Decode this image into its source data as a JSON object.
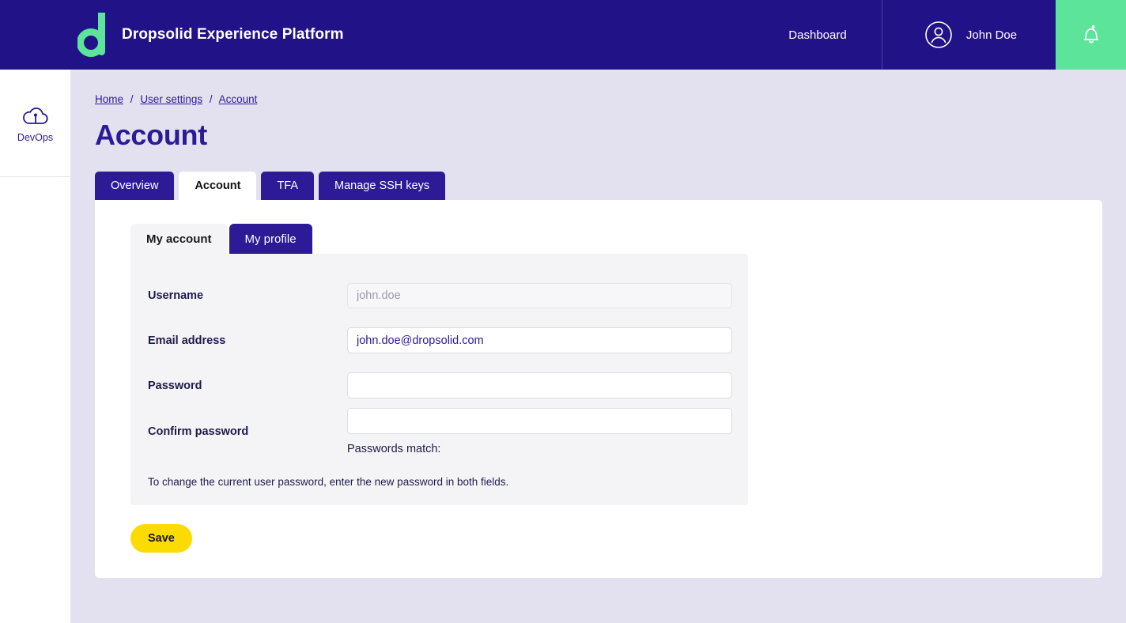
{
  "header": {
    "logo_icon": "dropsolid-d-logo",
    "brand_title": "Dropsolid Experience Platform",
    "dashboard_label": "Dashboard",
    "user_name": "John Doe",
    "avatar_icon": "user-circle-icon",
    "bell_icon": "bell-icon",
    "bg_color": "#221287",
    "bell_bg_color": "#5ce49b"
  },
  "sidebar": {
    "items": [
      {
        "label": "DevOps",
        "icon": "cloud-download-icon"
      }
    ]
  },
  "breadcrumb": {
    "items": [
      "Home",
      "User settings",
      "Account"
    ],
    "separator": "/"
  },
  "page": {
    "title": "Account",
    "accent_color": "#2c1a96",
    "background_color": "#e3e1f0"
  },
  "tabs": [
    {
      "label": "Overview",
      "active": false
    },
    {
      "label": "Account",
      "active": true
    },
    {
      "label": "TFA",
      "active": false
    },
    {
      "label": "Manage SSH keys",
      "active": false
    }
  ],
  "subtabs": [
    {
      "label": "My account",
      "active": true
    },
    {
      "label": "My profile",
      "active": false
    }
  ],
  "form": {
    "fields": [
      {
        "label": "Username",
        "value": "",
        "placeholder": "john.doe",
        "disabled": true,
        "type": "text"
      },
      {
        "label": "Email address",
        "value": "john.doe@dropsolid.com",
        "placeholder": "",
        "disabled": false,
        "type": "text"
      },
      {
        "label": "Password",
        "value": "",
        "placeholder": "",
        "disabled": false,
        "type": "password"
      },
      {
        "label": "Confirm password",
        "value": "",
        "placeholder": "",
        "disabled": false,
        "type": "password"
      }
    ],
    "passwords_match_label": "Passwords match:",
    "helper_text": "To change the current user password, enter the new password in both fields."
  },
  "actions": {
    "save_label": "Save",
    "save_color": "#fcdc00"
  }
}
